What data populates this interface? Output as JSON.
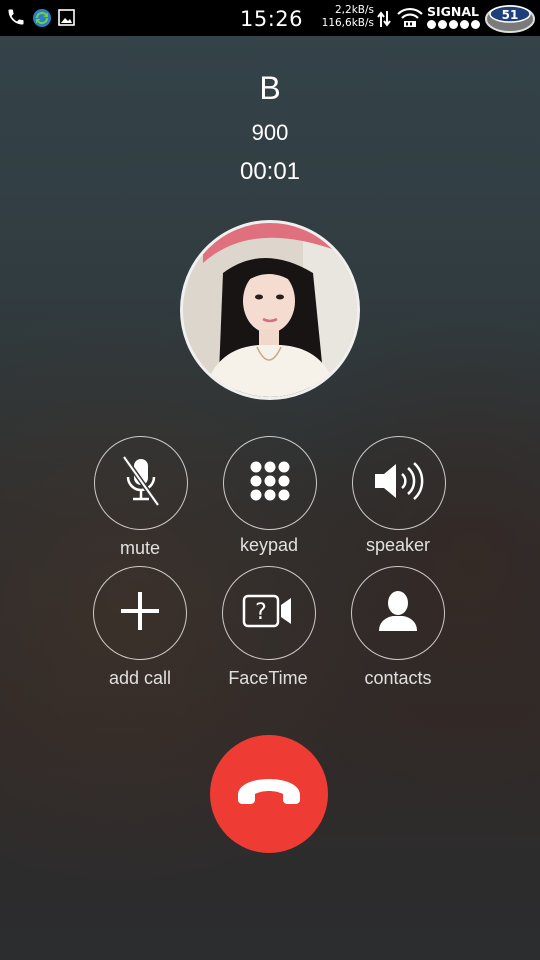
{
  "status_bar": {
    "time": "15:26",
    "upload_speed": "2,2kB/s",
    "download_speed": "116,6kB/s",
    "signal_label": "SIGNAL",
    "badge_text": "51",
    "icons": [
      "phone-icon",
      "sync-icon",
      "image-icon",
      "data-arrows-icon",
      "wifi-icon"
    ]
  },
  "call": {
    "name": "B",
    "number": "900",
    "duration": "00:01"
  },
  "controls": {
    "mute": "mute",
    "keypad": "keypad",
    "speaker": "speaker",
    "add_call": "add call",
    "facetime": "FaceTime",
    "contacts": "contacts"
  },
  "colors": {
    "end_call": "#ee3c34",
    "status_bar": "#000000"
  }
}
